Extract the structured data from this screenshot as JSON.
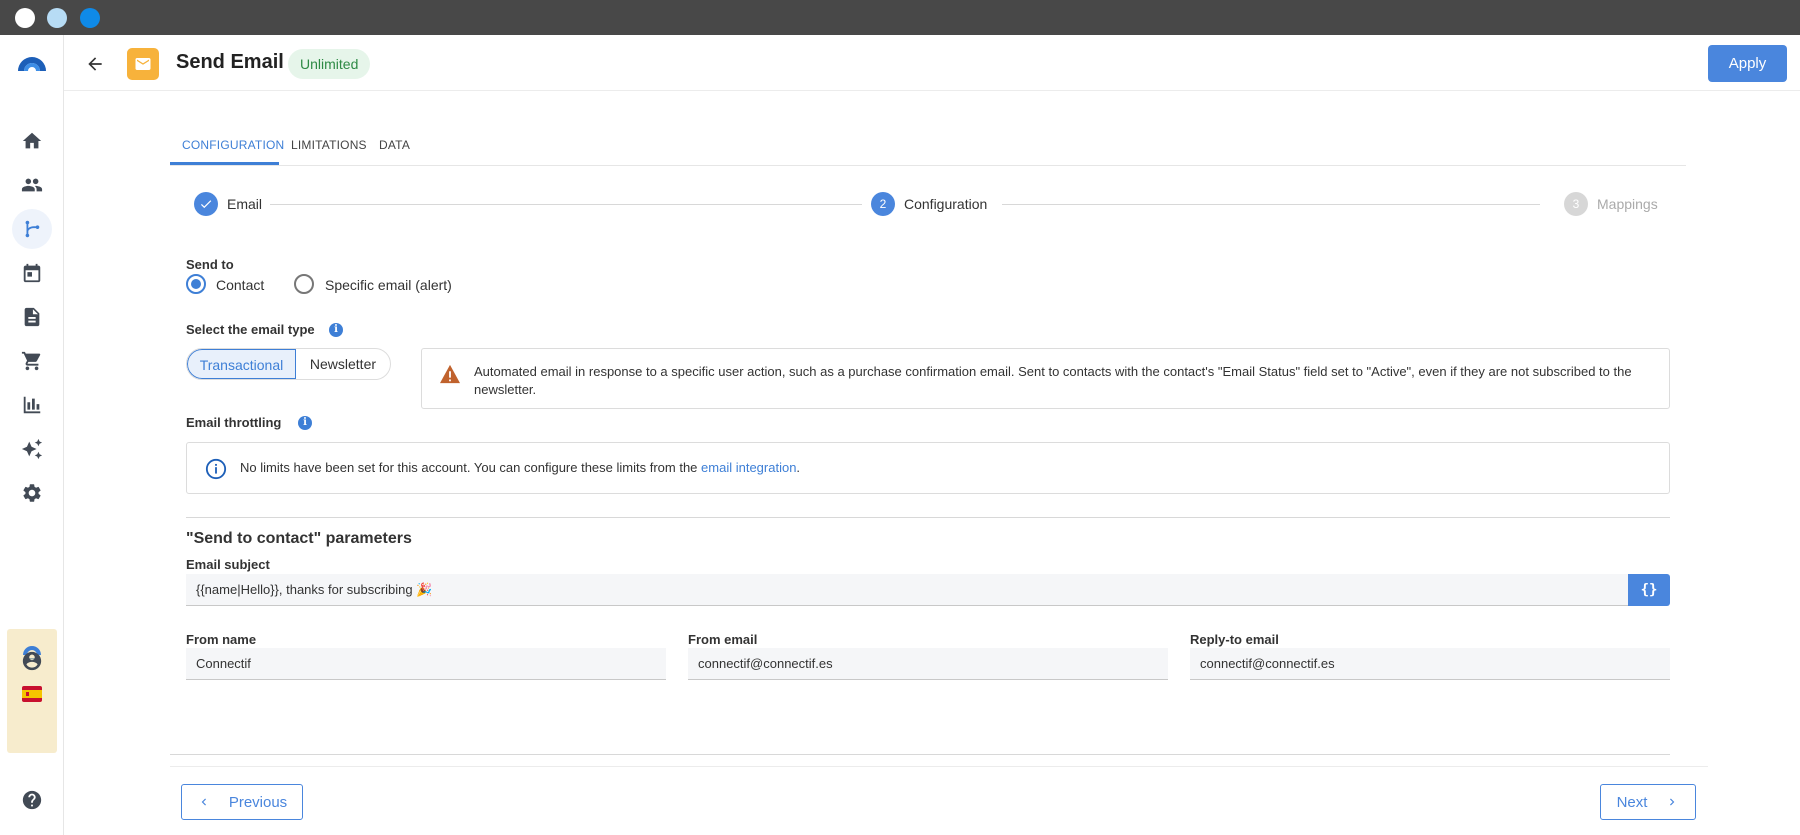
{
  "window": {
    "controls": [
      "close",
      "minimize",
      "maximize"
    ]
  },
  "sidebar": {
    "logo": "connectif-logo-icon",
    "items": [
      {
        "icon": "home-icon",
        "active": false
      },
      {
        "icon": "users-icon",
        "active": false
      },
      {
        "icon": "workflow-icon",
        "active": true
      },
      {
        "icon": "calendar-icon",
        "active": false
      },
      {
        "icon": "document-icon",
        "active": false
      },
      {
        "icon": "cart-icon",
        "active": false
      },
      {
        "icon": "chart-icon",
        "active": false
      },
      {
        "icon": "sparkle-icon",
        "active": false
      },
      {
        "icon": "settings-icon",
        "active": false
      }
    ],
    "bottom": [
      "account-icon",
      "help-icon"
    ]
  },
  "header": {
    "title": "Send Email",
    "badge": "Unlimited",
    "apply_label": "Apply"
  },
  "tabs": [
    {
      "label": "CONFIGURATION",
      "active": true
    },
    {
      "label": "LIMITATIONS",
      "active": false
    },
    {
      "label": "DATA",
      "active": false
    }
  ],
  "stepper": {
    "steps": [
      {
        "number": "1",
        "label": "Email",
        "state": "done"
      },
      {
        "number": "2",
        "label": "Configuration",
        "state": "active"
      },
      {
        "number": "3",
        "label": "Mappings",
        "state": "pending"
      }
    ]
  },
  "send_to": {
    "label": "Send to",
    "options": [
      "Contact",
      "Specific email (alert)"
    ],
    "selected": "Contact"
  },
  "email_type": {
    "label": "Select the email type",
    "options": [
      "Transactional",
      "Newsletter"
    ],
    "selected": "Transactional",
    "warning": "Automated email in response to a specific user action, such as a purchase confirmation email. Sent to contacts with the contact's \"Email Status\" field set to \"Active\", even if they are not subscribed to the newsletter."
  },
  "throttling": {
    "label": "Email throttling",
    "info_prefix": "No limits have been set for this account. You can configure these limits from the ",
    "info_link": "email integration",
    "info_suffix": "."
  },
  "params": {
    "title": "\"Send to contact\" parameters",
    "subject_label": "Email subject",
    "subject_value": "{{name|Hello}}, thanks for subscribing 🎉",
    "code_button": "{}",
    "from_name_label": "From name",
    "from_name_value": "Connectif",
    "from_email_label": "From email",
    "from_email_value": "connectif@connectif.es",
    "reply_to_label": "Reply-to email",
    "reply_to_value": "connectif@connectif.es"
  },
  "footer": {
    "previous_label": "Previous",
    "next_label": "Next"
  },
  "colors": {
    "accent": "#3e7fd6",
    "button": "#4a86dd",
    "mail_tile": "#f7b23b",
    "badge_bg": "#e6f5ea",
    "badge_text": "#2e8a45",
    "warning": "#c0622d"
  }
}
